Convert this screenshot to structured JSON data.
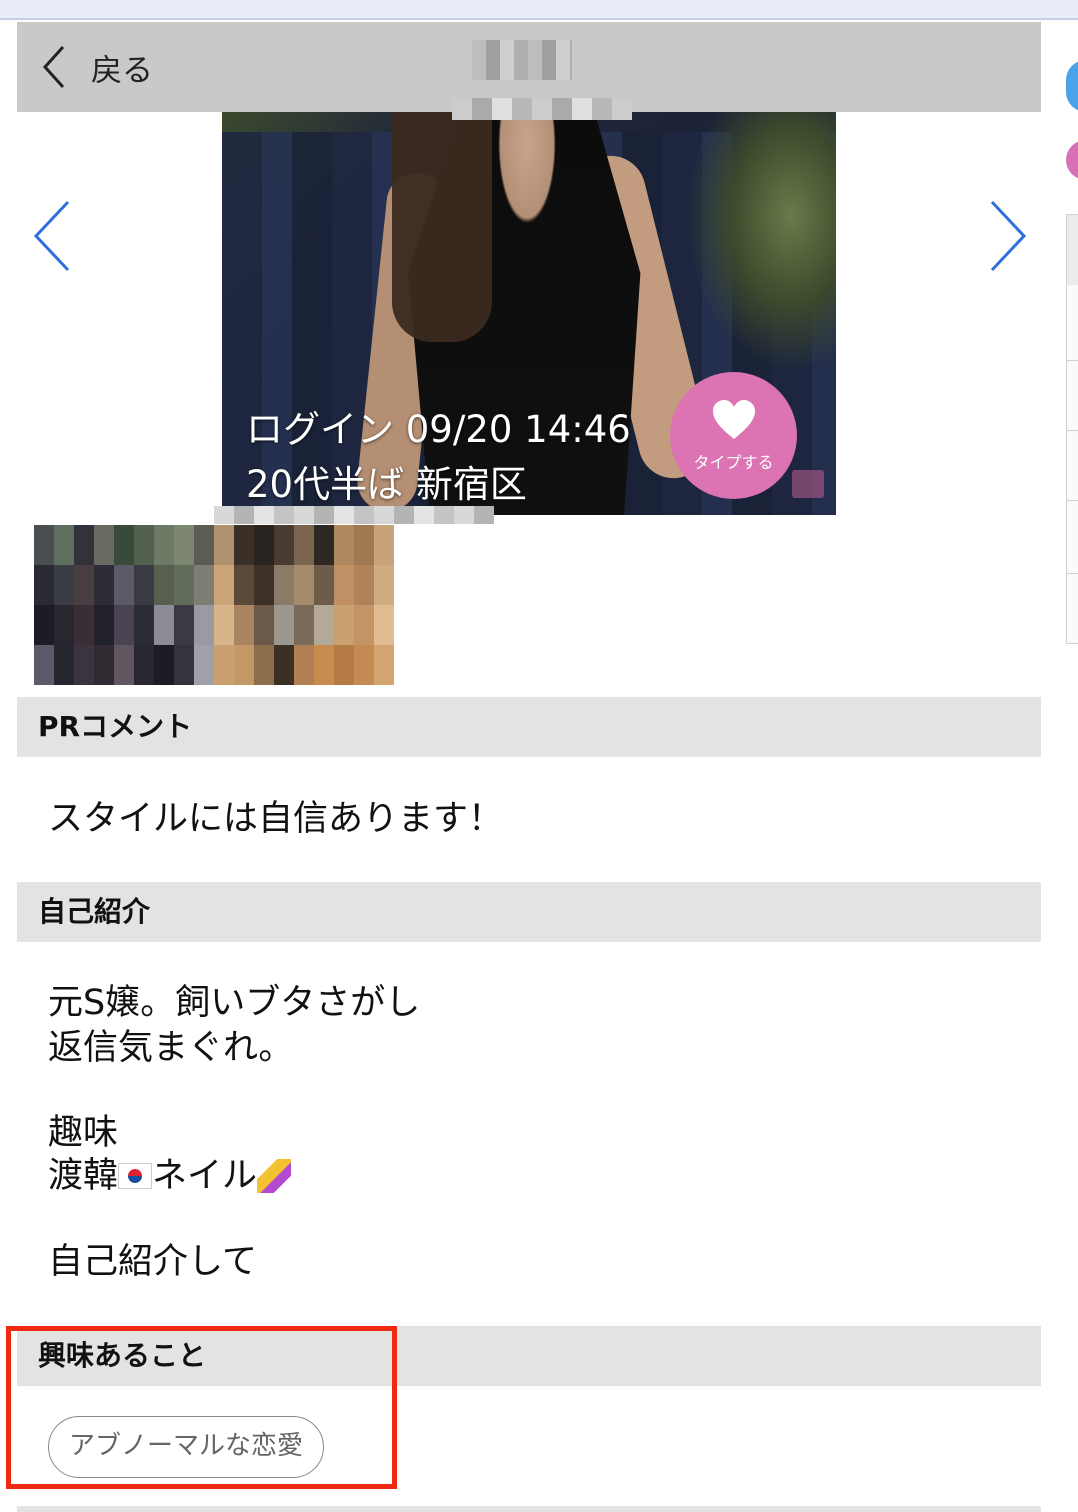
{
  "header": {
    "back_label": "戻る"
  },
  "photo": {
    "login_text": "ログイン 09/20 14:46",
    "profile_text": "20代半ば 新宿区",
    "like_label": "タイプする"
  },
  "sections": {
    "pr": {
      "heading": "PRコメント",
      "body": "スタイルには自信あります！"
    },
    "intro": {
      "heading": "自己紹介",
      "line1": "元S嬢。飼いブタさがし",
      "line2": "返信気まぐれ。",
      "line3": "趣味",
      "line4_prefix": "渡韓",
      "line4_middle": "ネイル",
      "line5": "自己紹介して"
    },
    "interests": {
      "heading": "興味あること",
      "tags": [
        "アブノーマルな恋愛"
      ]
    }
  },
  "colors": {
    "header_bg": "#c9c9c9",
    "section_bg": "#e3e3e3",
    "like_pink": "#dc73b3",
    "arrow_blue": "#2f6fdc",
    "highlight_red": "#f02a10"
  },
  "icons": {
    "back": "chevron-left-icon",
    "prev": "chevron-left-icon",
    "next": "chevron-right-icon",
    "like": "heart-icon",
    "flag": "korea-flag-icon",
    "nail": "nail-polish-icon"
  }
}
